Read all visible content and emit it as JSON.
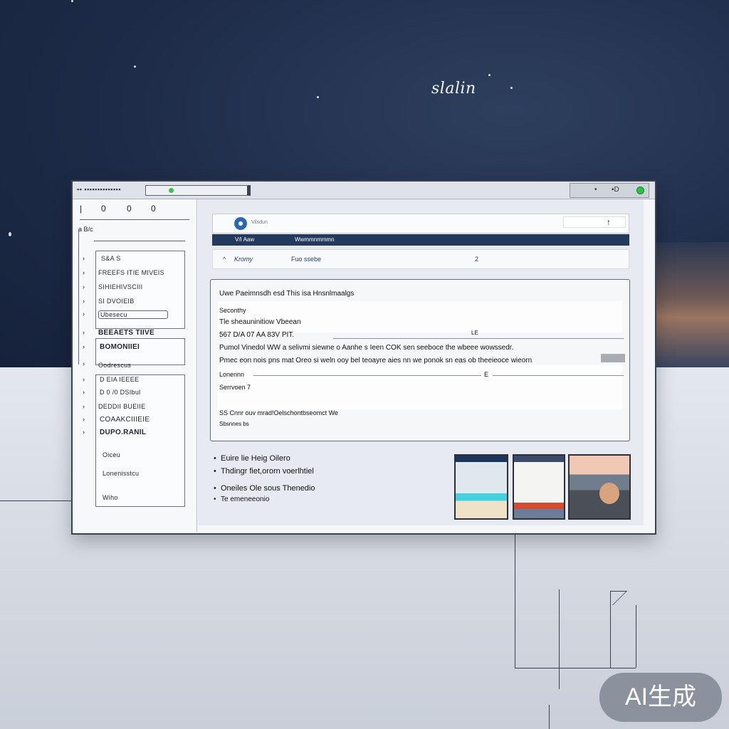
{
  "brand": {
    "text": "slalin"
  },
  "window": {
    "title": "▪▪ ▪▪▪▪▪▪▪▪▪▪▪▪▪▪",
    "controls": [
      "•",
      "▪D"
    ]
  },
  "sidebar": {
    "tools": [
      "0",
      "0",
      "0"
    ],
    "heading": "a B/c",
    "items": [
      {
        "label": "S&A S",
        "bold": false
      },
      {
        "label": "FREEFS ITIE MIVEIS",
        "bold": false
      },
      {
        "label": "SIHIEHIVSCIII",
        "bold": false
      },
      {
        "label": "SI DVOIEIB",
        "bold": false
      },
      {
        "label": "Ubesecu",
        "bold": false
      },
      {
        "label": "BEEAETS TIIVE",
        "bold": true
      },
      {
        "label": "BOMONIIEI",
        "bold": true
      },
      {
        "label": "Oodrescus",
        "bold": false
      },
      {
        "label": "D EIA IEEEE",
        "bold": false
      },
      {
        "label": "D 0 /0 DSIbul",
        "bold": false
      },
      {
        "label": "DEDDII BUEIIE",
        "bold": false
      },
      {
        "label": "COAAKCIIIEIE",
        "bold": false
      },
      {
        "label": "DUPO.RANIL",
        "bold": true
      },
      {
        "label": "Oiceu",
        "bold": false
      },
      {
        "label": "Lonenisstcu",
        "bold": false
      },
      {
        "label": "Wiho",
        "bold": false
      }
    ]
  },
  "main": {
    "header": {
      "small": "Vilsdun",
      "button": "↑"
    },
    "nav": {
      "left": "V/I Aaw",
      "right": "Wwmmnmmmn"
    },
    "subbar": {
      "left": "Kromy",
      "right": "Fuo ssebe",
      "mid": "2"
    },
    "card": {
      "title": "Uwe Paeimnsdh esd This isa Hnsnlmaalgs",
      "line1": "Seconthy",
      "line2": "Tle sheauninitiow Vbeean",
      "line3": "567 D/A 07 AA 83V PIT.",
      "line3_right": "LE",
      "line4": "Pumol Vinedol WW a selivmi siewne o Aanhe s Ieen COK sen seeboce the wbeee wowssedr.",
      "line5": "Pmec eon nois pns mat Oreo si weln ooy bel teoayre aies nn we ponok sn eas ob theeieoce wieorn",
      "line6": "Lonennn",
      "line6_right": "E",
      "line7": "Serrvoen 7",
      "line8": "SS Cnnr ouv mrad!Oelschontbseomct We",
      "line9": "Sbsnnes bs"
    },
    "bullets": [
      "Euire lie Heig Oilero",
      "Thdingr fiet,ororn voerlhtiel",
      "Oneiles Ole sous Thenedio",
      "Te emeneeonio"
    ]
  },
  "badge": {
    "text": "AI生成"
  },
  "colors": {
    "navy": "#23395e",
    "accent": "#2b68b3",
    "green": "#27c34a"
  }
}
